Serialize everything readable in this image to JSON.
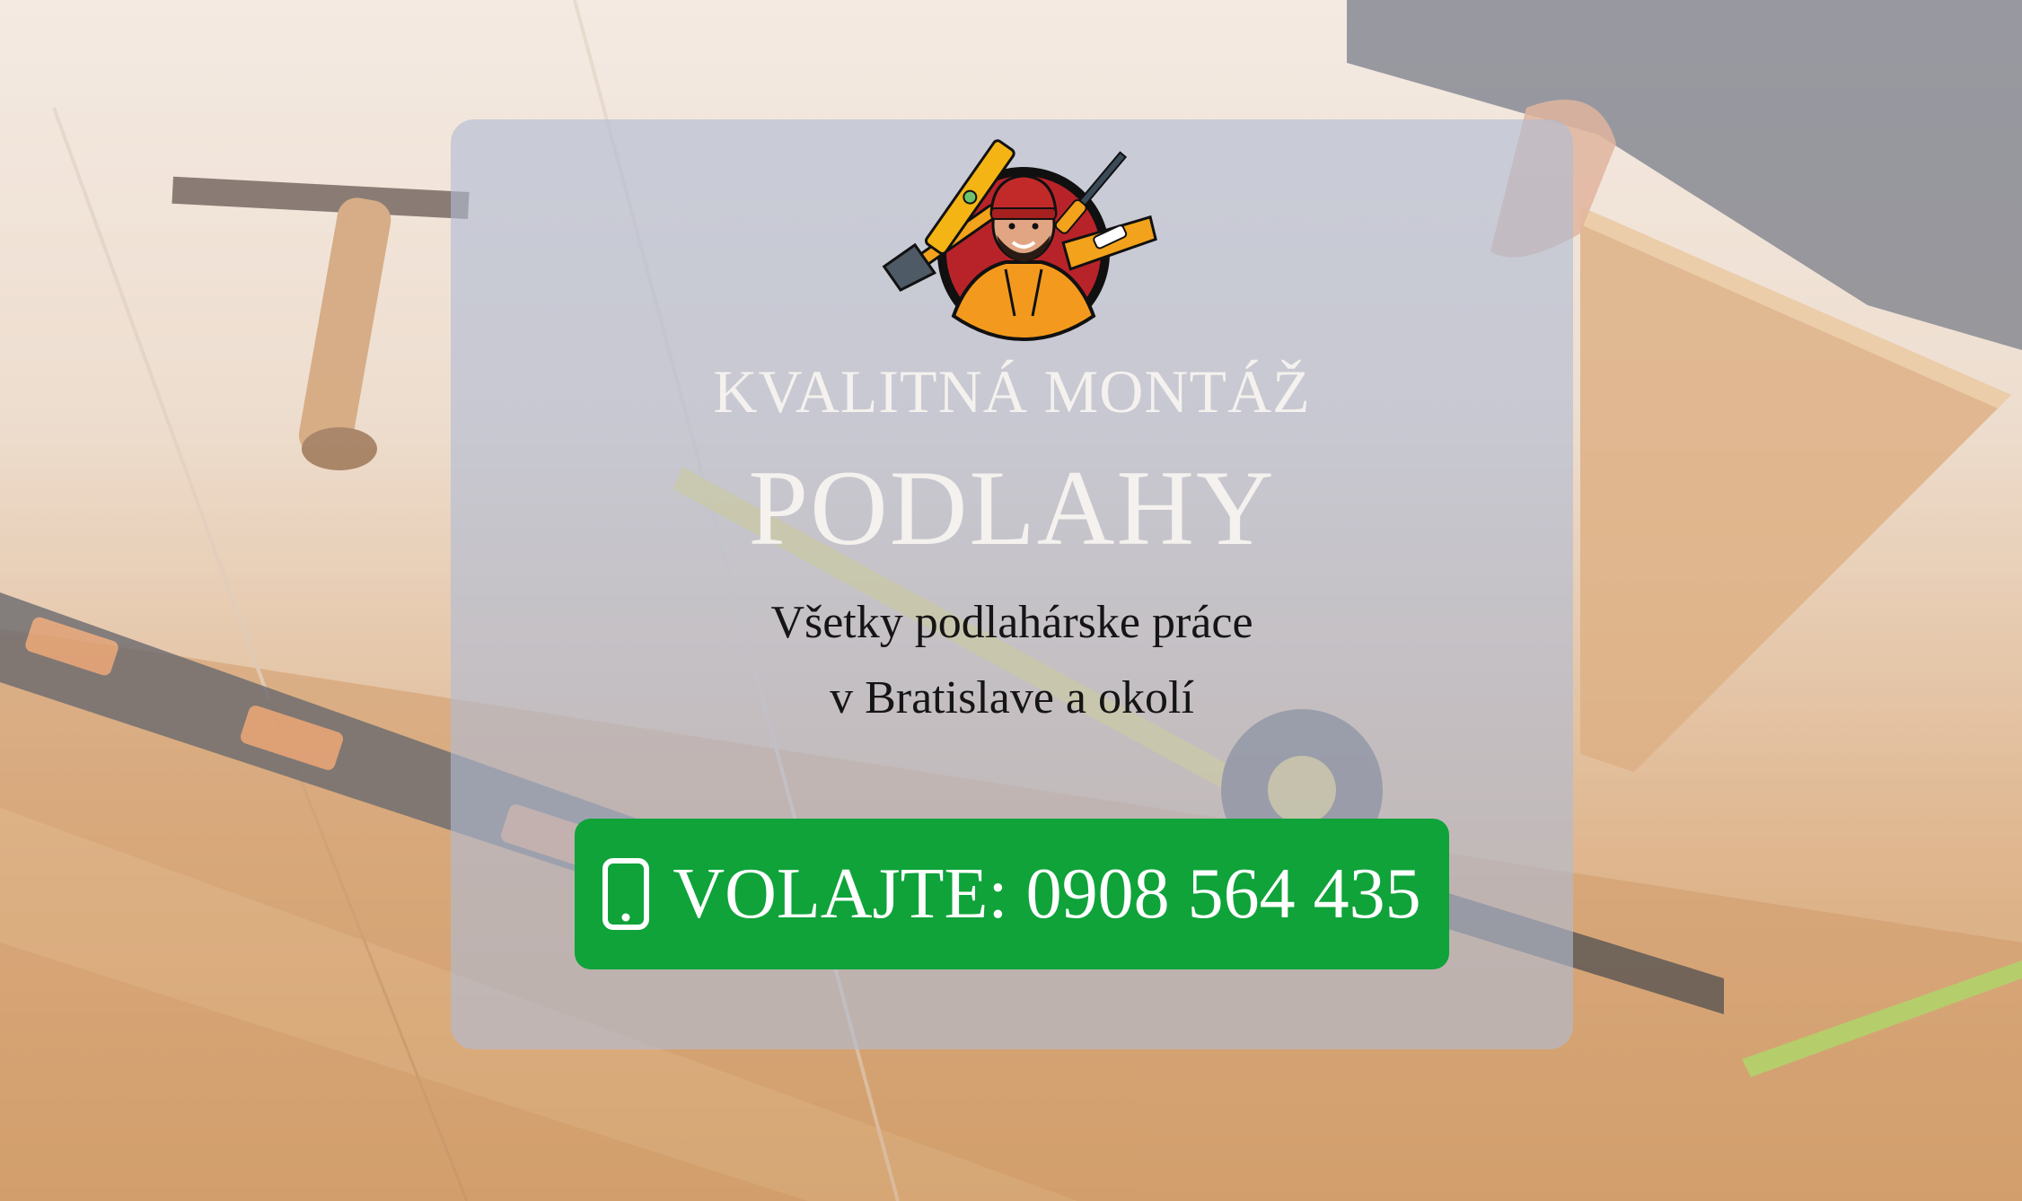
{
  "hero": {
    "kicker": "KVALITNÁ MONTÁŽ",
    "title": "PODLAHY",
    "subtitle_line1": "Všetky podlahárske práce",
    "subtitle_line2": "v Bratislave a okolí",
    "cta_label": "VOLAJTE: 0908 564 435",
    "cta_icon": "smartphone-icon",
    "logo_icon": "handyman-mascot-logo"
  },
  "colors": {
    "accent_green": "#0fa33a",
    "panel_overlay": "#b0bcd4",
    "light_text": "#f4f1ee",
    "dark_text": "#151515"
  }
}
